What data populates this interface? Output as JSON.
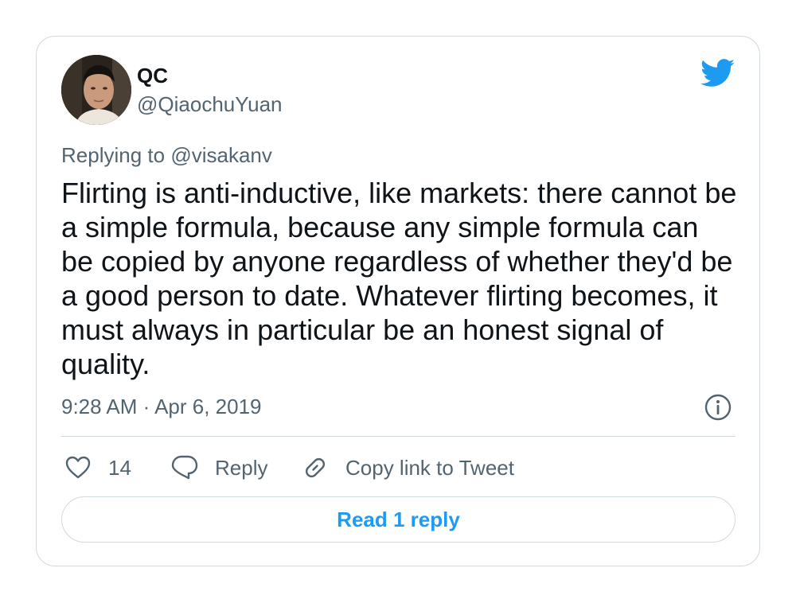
{
  "author": {
    "name": "QC",
    "handle": "@QiaochuYuan"
  },
  "reply": {
    "prefix": "Replying to",
    "target": "@visakanv"
  },
  "tweet": {
    "text": "Flirting is anti-inductive, like markets: there cannot be a simple formula, because any simple formula can be copied by anyone regardless of whether they'd be a good person to date. Whatever flirting becomes, it must always in particular be an honest signal of quality.",
    "timestamp": "9:28 AM · Apr 6, 2019"
  },
  "actions": {
    "like_count": "14",
    "reply_label": "Reply",
    "copy_link_label": "Copy link to Tweet"
  },
  "read_replies_label": "Read 1 reply",
  "icons": {
    "brand": "twitter-bird-icon",
    "info": "info-icon",
    "like": "heart-icon",
    "reply": "speech-bubble-icon",
    "copy": "link-icon"
  },
  "colors": {
    "accent": "#1d9bf0",
    "text_primary": "#0f1419",
    "text_secondary": "#536471",
    "border": "#cfd9de"
  }
}
